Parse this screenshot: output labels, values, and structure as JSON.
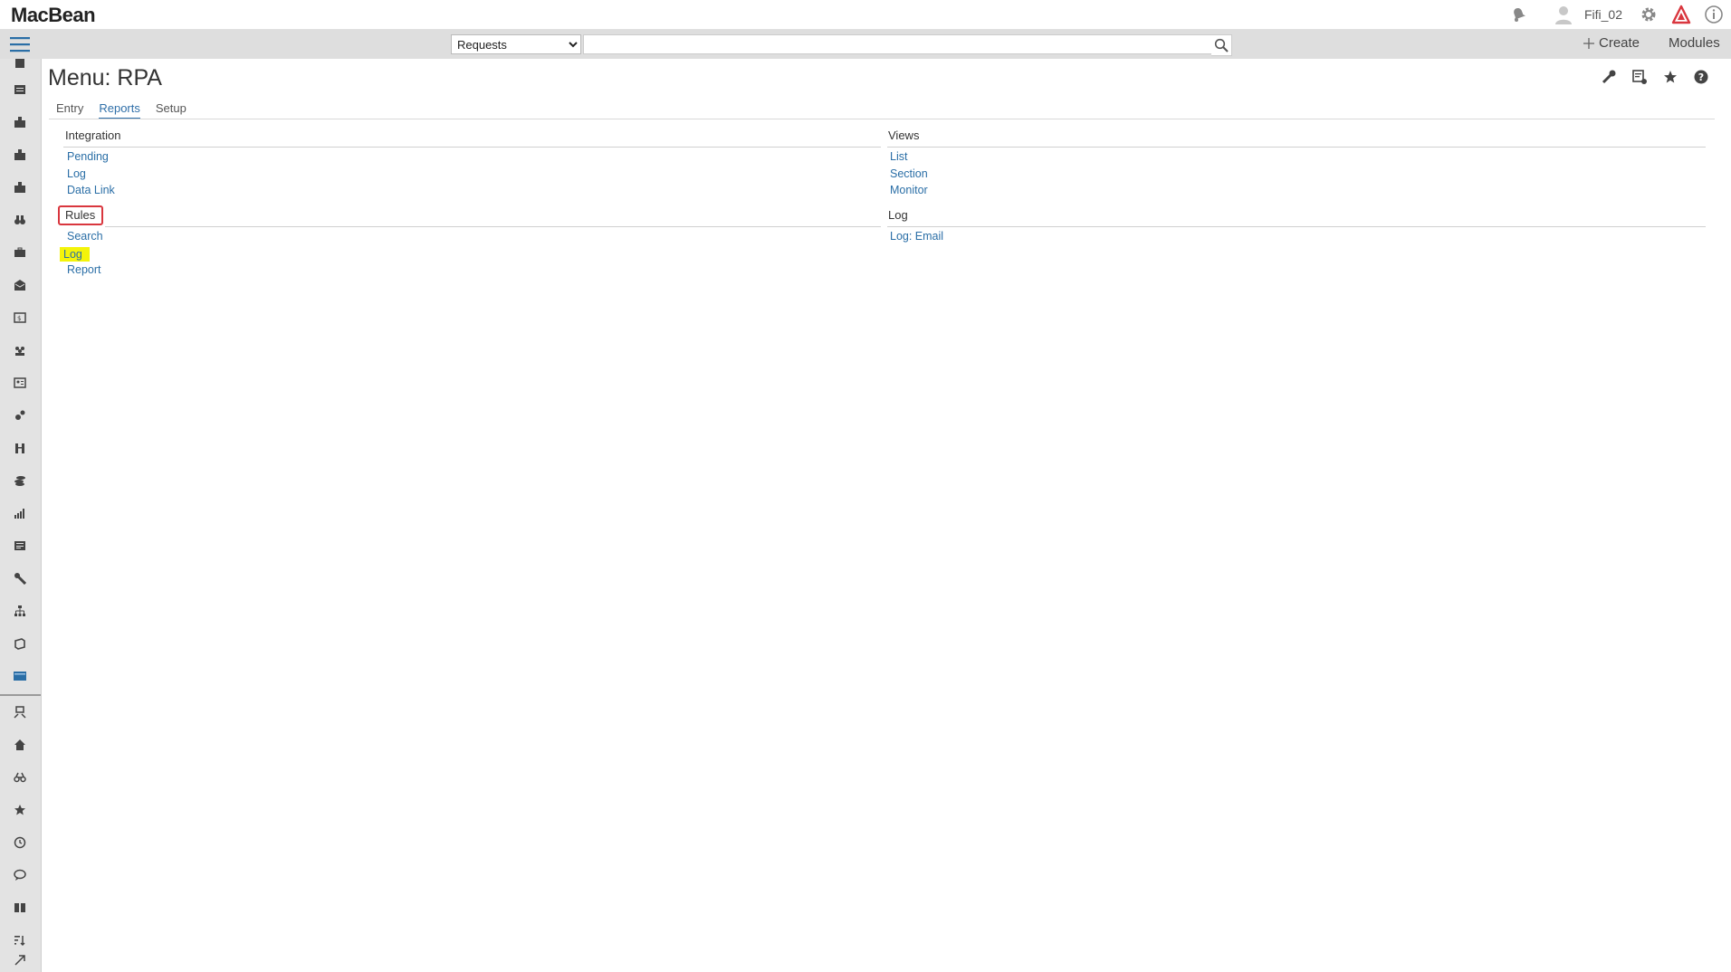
{
  "app": {
    "name": "MacBean"
  },
  "header": {
    "username": "Fifi_02",
    "icons": [
      "bell-icon",
      "user-avatar-icon",
      "gear-icon",
      "alert-triangle-icon",
      "info-icon"
    ]
  },
  "toolbar": {
    "search_scope": "Requests",
    "search_placeholder": "",
    "create_label": "Create",
    "modules_label": "Modules"
  },
  "page": {
    "title": "Menu: RPA",
    "tabs": [
      {
        "label": "Entry"
      },
      {
        "label": "Reports"
      },
      {
        "label": "Setup"
      }
    ],
    "active_tab": "Reports"
  },
  "sections": {
    "integration": {
      "title": "Integration",
      "links": [
        "Pending",
        "Log",
        "Data Link"
      ]
    },
    "views": {
      "title": "Views",
      "links": [
        "List",
        "Section",
        "Monitor"
      ]
    },
    "rules": {
      "title": "Rules",
      "links": [
        "Search",
        "Log",
        "Report"
      ]
    },
    "log": {
      "title": "Log",
      "links": [
        "Log: Email"
      ]
    }
  },
  "colors": {
    "link": "#2a6ea6",
    "highlight": "#f4f40a",
    "annotation_box": "#d9363e",
    "alert": "#d9363e",
    "rail_bg": "#e3e3e3"
  }
}
